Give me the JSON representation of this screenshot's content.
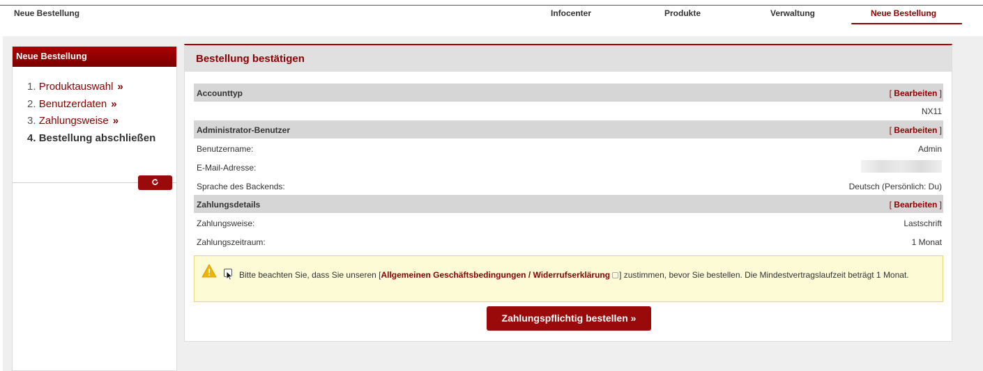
{
  "brand": "Neue Bestellung",
  "nav": [
    {
      "label": "Infocenter",
      "active": false
    },
    {
      "label": "Produkte",
      "active": false
    },
    {
      "label": "Verwaltung",
      "active": false
    },
    {
      "label": "Neue Bestellung",
      "active": true
    }
  ],
  "sidebar": {
    "title": "Neue Bestellung",
    "steps": [
      {
        "num": "1.",
        "label": "Produktauswahl",
        "arrow": "»"
      },
      {
        "num": "2.",
        "label": "Benutzerdaten",
        "arrow": "»"
      },
      {
        "num": "3.",
        "label": "Zahlungsweise",
        "arrow": "»"
      },
      {
        "num": "4.",
        "label": "Bestellung abschließen"
      }
    ],
    "refresh_icon": "refresh-icon"
  },
  "main": {
    "title": "Bestellung bestätigen",
    "edit_label": "Bearbeiten",
    "sections": {
      "account": {
        "title": "Accounttyp",
        "value": "NX11"
      },
      "admin": {
        "title": "Administrator-Benutzer",
        "rows": [
          {
            "label": "Benutzername:",
            "value": "Admin"
          },
          {
            "label": "E-Mail-Adresse:",
            "value": ""
          },
          {
            "label": "Sprache des Backends:",
            "value": "Deutsch (Persönlich: Du)"
          }
        ]
      },
      "payment": {
        "title": "Zahlungsdetails",
        "rows": [
          {
            "label": "Zahlungsweise:",
            "value": "Lastschrift"
          },
          {
            "label": "Zahlungszeitraum:",
            "value": "1 Monat"
          }
        ]
      }
    },
    "notice": {
      "before": "Bitte beachten Sie, dass Sie unseren [",
      "link": "Allgemeinen Geschäftsbedingungen / Widerrufserklärung",
      "after": "] zustimmen, bevor Sie bestellen. Die Mindestvertragslaufzeit beträgt 1 Monat.",
      "checked": false
    },
    "order_button": "Zahlungspflichtig bestellen »"
  },
  "colors": {
    "accent": "#8b0000",
    "notice_bg": "#fdfbd6",
    "section_bg": "#d6d6d6"
  }
}
